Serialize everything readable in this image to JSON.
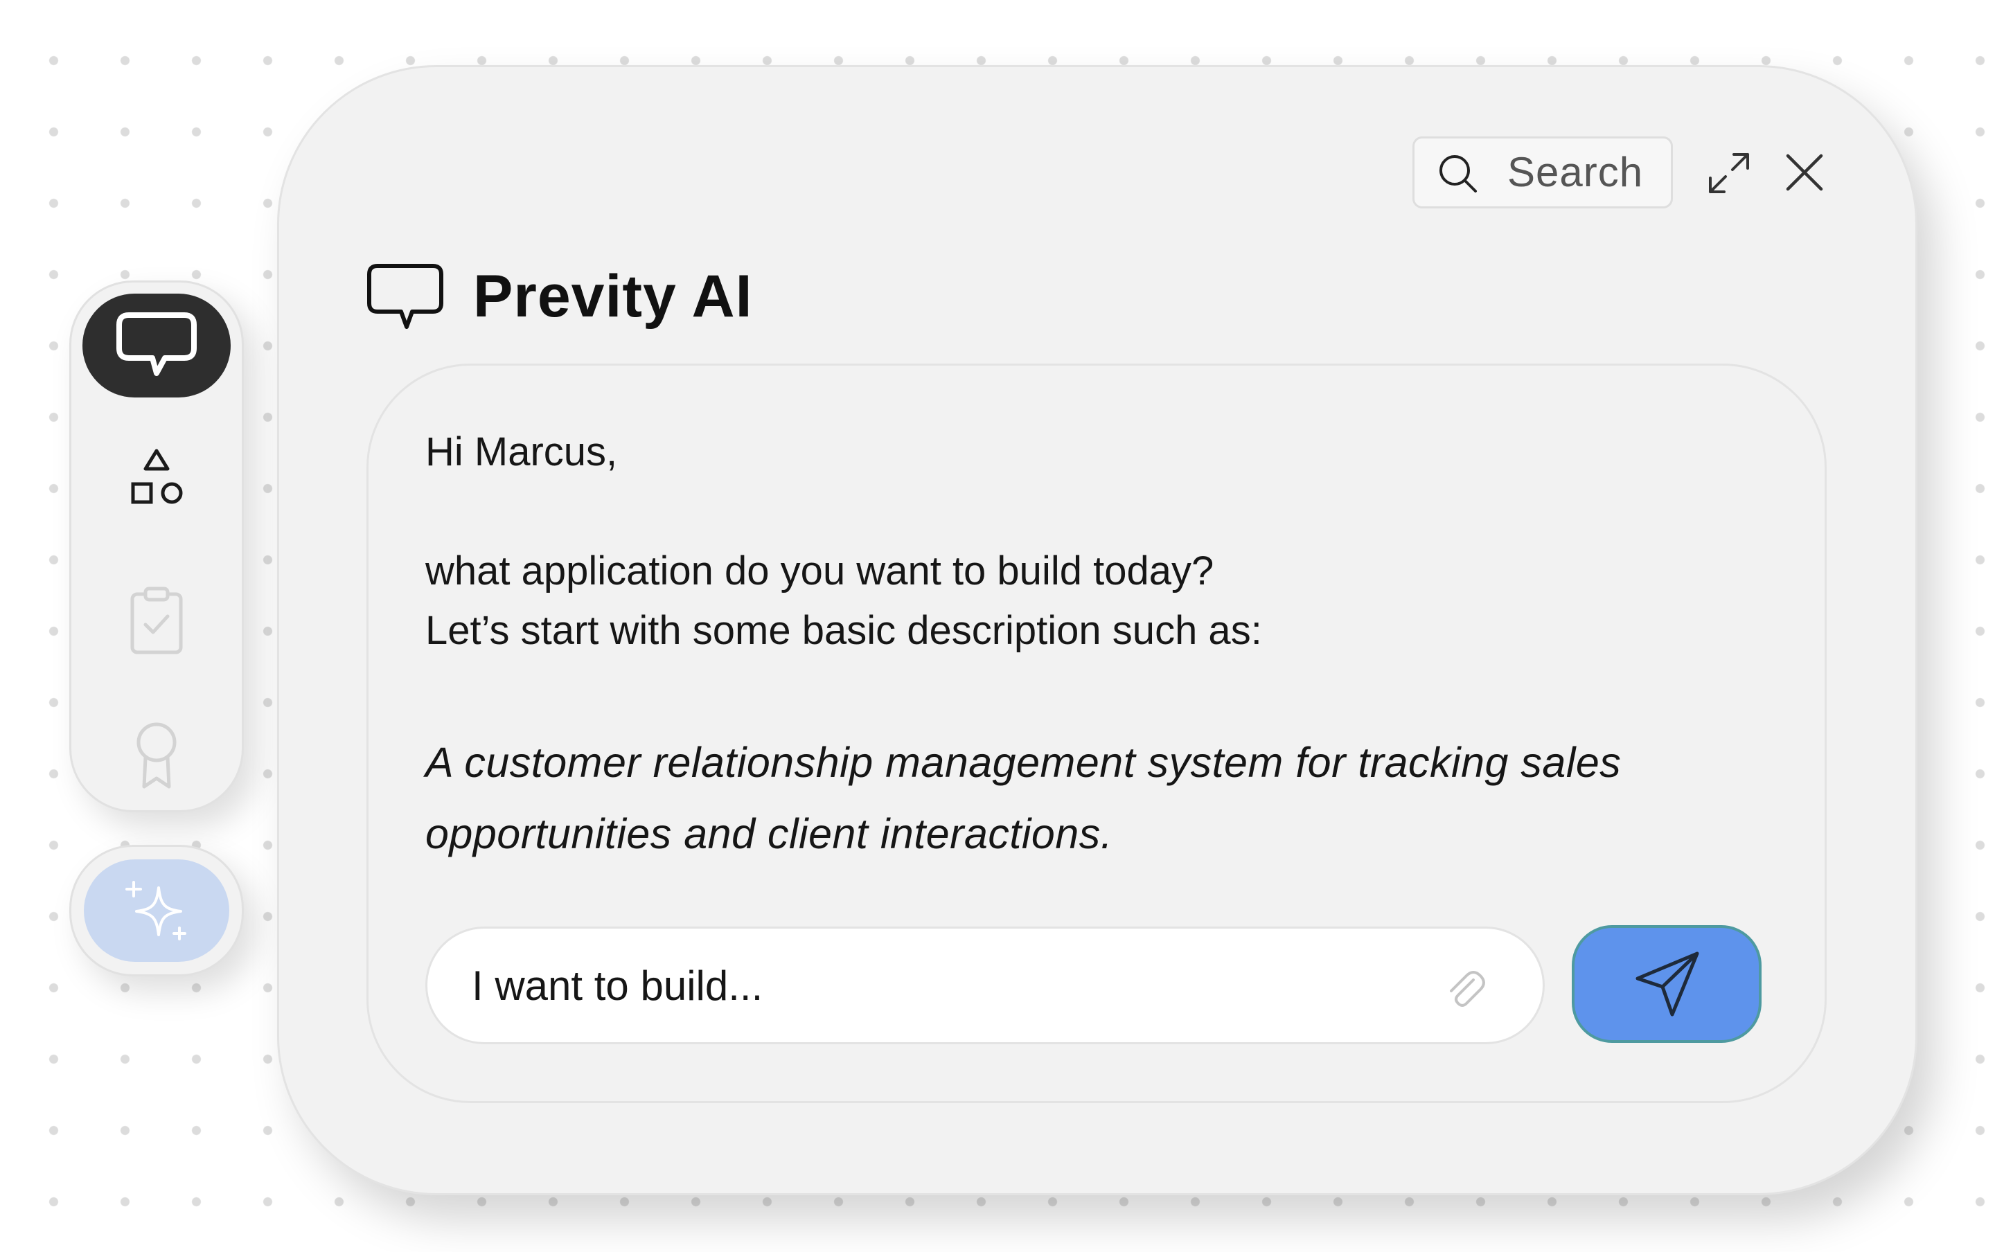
{
  "rail": {
    "items": [
      {
        "name": "chat",
        "icon": "chat-bubble-icon",
        "active": true
      },
      {
        "name": "components",
        "icon": "shapes-icon",
        "active": false
      },
      {
        "name": "tasks",
        "icon": "clipboard-check-icon",
        "active": false
      },
      {
        "name": "achievements",
        "icon": "award-icon",
        "active": false
      }
    ],
    "ai_button_icon": "sparkle-icon"
  },
  "header": {
    "search_placeholder": "Search",
    "search_icon": "search-icon",
    "expand_icon": "expand-icon",
    "close_icon": "close-icon"
  },
  "title": {
    "icon": "chat-bubble-icon",
    "text": "Previty AI"
  },
  "chat": {
    "greeting": "Hi Marcus,",
    "question": "what application do you want to build today?",
    "lead": "Let’s start with some basic description such as:",
    "example": "A customer relationship management system for tracking sales opportunities and client interactions."
  },
  "composer": {
    "placeholder": "I want to build...",
    "attach_icon": "paperclip-icon",
    "send_icon": "send-icon"
  },
  "colors": {
    "background": "#ffffff",
    "dot": "#dcdcdc",
    "card": "#f2f2f2",
    "active_rail_item": "#2e2e2e",
    "ai_button": "#c9d8f1",
    "send_button": "#5e93ec",
    "send_button_border": "#4e9aa0",
    "text": "#161616"
  }
}
